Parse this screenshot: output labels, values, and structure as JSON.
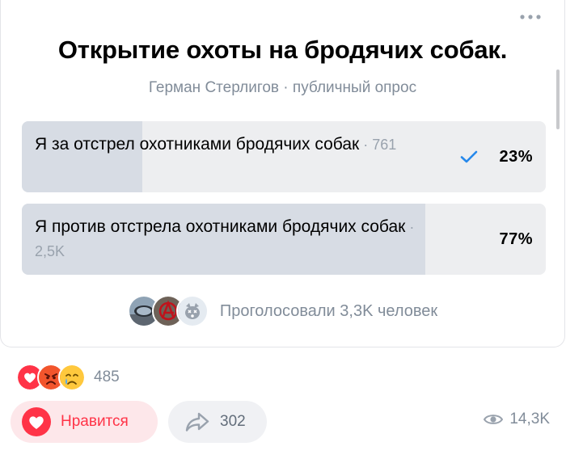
{
  "poll": {
    "title": "Открытие охоты на бродячих собак.",
    "subtitle": "Герман Стерлигов · публичный опрос",
    "options": [
      {
        "text": "Я за отстрел охотниками бродячих собак",
        "votes": "761",
        "percent_label": "23%",
        "percent": 23,
        "selected": true
      },
      {
        "text": "Я против отстрела охотниками бродячих собак",
        "votes": "2,5K",
        "percent_label": "77%",
        "percent": 77,
        "selected": false
      }
    ],
    "voters_text": "Проголосовали 3,3K человек",
    "voter_avatars": [
      "avatar-car-mirror",
      "avatar-anarchy",
      "avatar-dog"
    ]
  },
  "reactions": {
    "icons": [
      "heart-icon",
      "angry-face-icon",
      "crying-face-icon"
    ],
    "count": "485"
  },
  "actions": {
    "like_label": "Нравится",
    "share_count": "302",
    "views_count": "14,3K"
  },
  "colors": {
    "accent_red": "#ff3347",
    "check_blue": "#2688eb",
    "option_bg": "#edeef0",
    "option_fill": "#d7dce4",
    "secondary_text": "#818c99"
  }
}
